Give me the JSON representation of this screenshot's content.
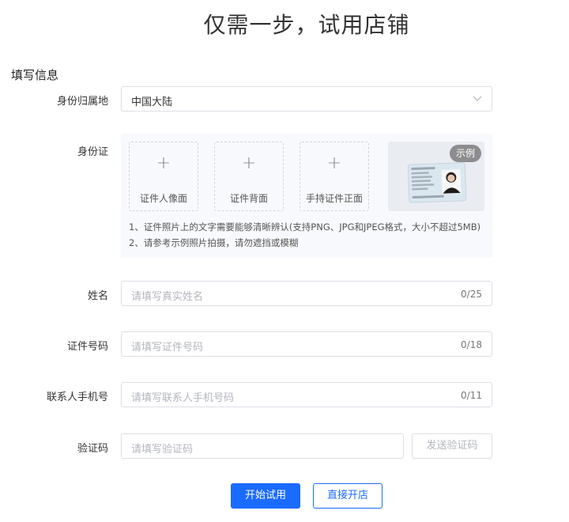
{
  "page": {
    "title": "仅需一步，试用店铺"
  },
  "form": {
    "section_title": "填写信息",
    "region": {
      "label": "身份归属地",
      "value": "中国大陆"
    },
    "id_card": {
      "label": "身份证",
      "uploads": [
        {
          "label": "证件人像面"
        },
        {
          "label": "证件背面"
        },
        {
          "label": "手持证件正面"
        }
      ],
      "example_badge": "示例",
      "hints": [
        "1、证件照片上的文字需要能够清晰辨认(支持PNG、JPG和JPEG格式，大小不超过5MB)",
        "2、请参考示例照片拍摄，请勿遮挡或模糊"
      ]
    },
    "name": {
      "label": "姓名",
      "placeholder": "请填写真实姓名",
      "counter": "0/25"
    },
    "id_number": {
      "label": "证件号码",
      "placeholder": "请填写证件号码",
      "counter": "0/18"
    },
    "phone": {
      "label": "联系人手机号",
      "placeholder": "请填写联系人手机号码",
      "counter": "0/11"
    },
    "code": {
      "label": "验证码",
      "placeholder": "请填写验证码",
      "send_label": "发送验证码"
    }
  },
  "actions": {
    "primary_label": "开始试用",
    "secondary_label": "直接开店"
  },
  "colors": {
    "accent": "#1a6bff",
    "border": "#dcdfe6",
    "panel": "#f8f9fc"
  }
}
